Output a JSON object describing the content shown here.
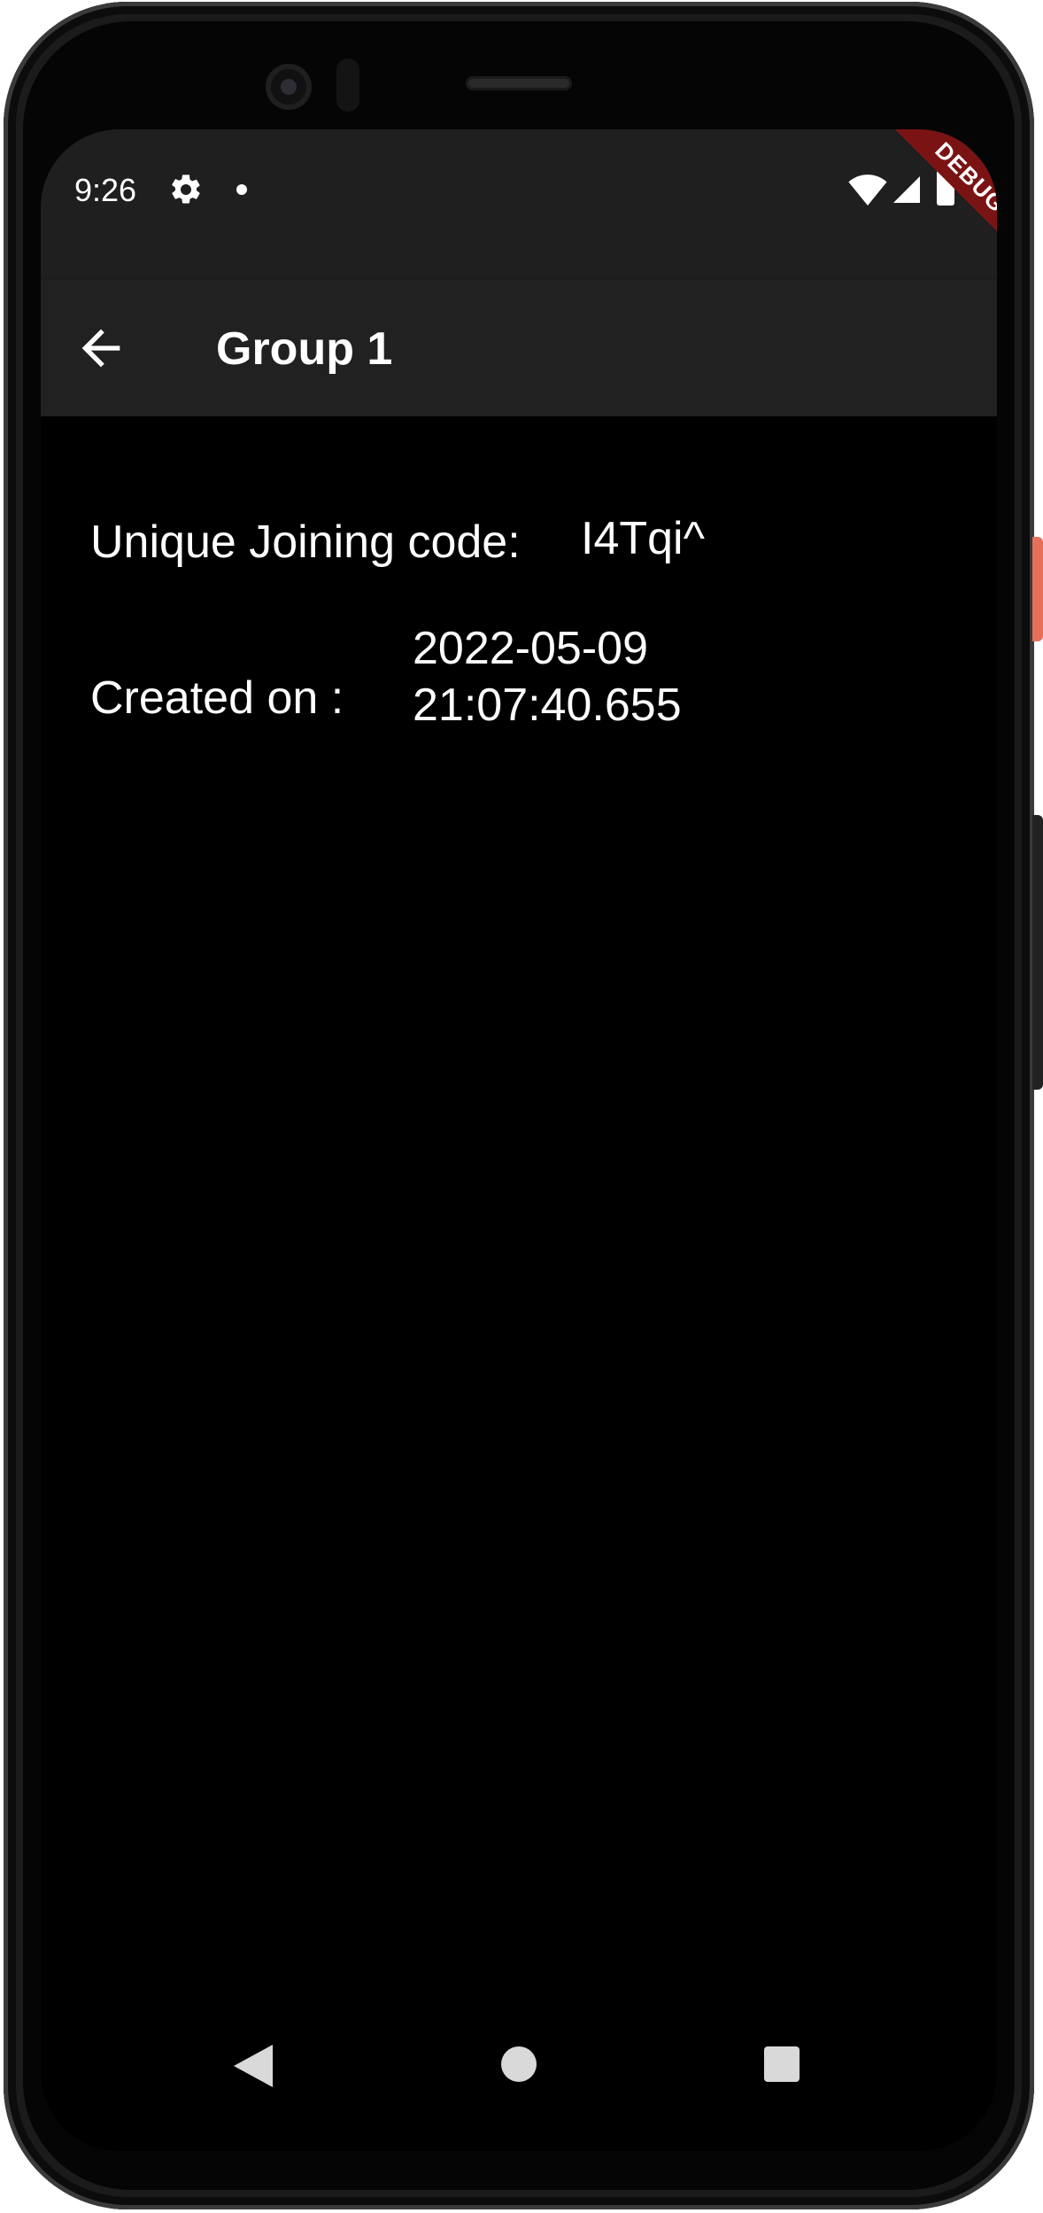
{
  "status_bar": {
    "time": "9:26",
    "icons": [
      "gear-icon",
      "notification-dot-icon",
      "wifi-icon",
      "signal-icon",
      "battery-icon"
    ],
    "debug_label": "DEBUG",
    "debug_color": "#7a1414"
  },
  "app_bar": {
    "back_icon": "arrow-left-icon",
    "title": "Group 1"
  },
  "group_info": {
    "code_label": "Unique Joining code:",
    "code_value": "I4Tqi^",
    "created_label": "Created on :",
    "created_value": "2022-05-09 21:07:40.655"
  },
  "nav_bar": {
    "icons": [
      "back-triangle-icon",
      "home-circle-icon",
      "recents-square-icon"
    ]
  },
  "colors": {
    "background": "#000000",
    "app_bar": "#212121",
    "status_bar": "#1f1f1f",
    "text": "#ffffff"
  }
}
